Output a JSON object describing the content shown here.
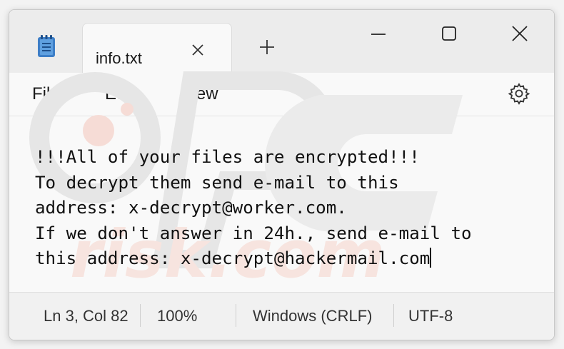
{
  "window": {
    "tab_title": "info.txt",
    "tab_close_icon": "close-icon",
    "new_tab_icon": "plus-icon",
    "controls": [
      "minimize-icon",
      "maximize-icon",
      "close-icon"
    ]
  },
  "menu": {
    "file": "File",
    "edit": "Edit",
    "view": "View",
    "settings_icon": "gear-icon"
  },
  "editor": {
    "text": "!!!All of your files are encrypted!!!\nTo decrypt them send e-mail to this\naddress: x-decrypt@worker.com.\nIf we don't answer in 24h., send e-mail to\nthis address: x-decrypt@hackermail.com"
  },
  "status": {
    "position": "Ln 3, Col 82",
    "zoom": "100%",
    "line_endings": "Windows (CRLF)",
    "encoding": "UTF-8"
  },
  "colors": {
    "window_bg": "#f9f9f9",
    "titlebar_bg": "#ececec",
    "app_icon": "#2b6cb0"
  }
}
